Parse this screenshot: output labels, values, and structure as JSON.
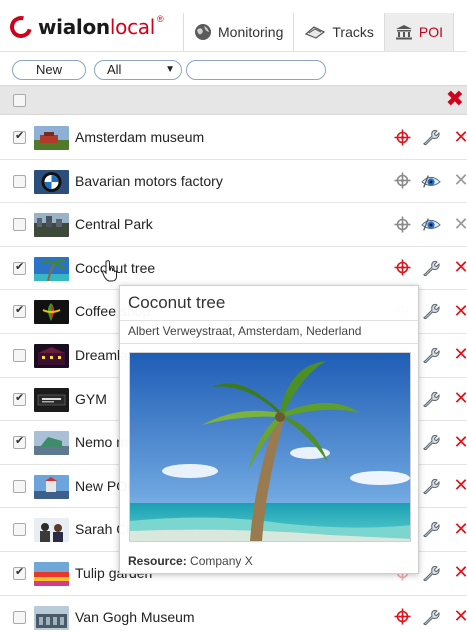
{
  "app": {
    "logo_text": "wialon",
    "logo_accent": "local",
    "logo_sup": "®"
  },
  "tabs": [
    {
      "label": "Monitoring",
      "icon": "globe-icon",
      "active": false
    },
    {
      "label": "Tracks",
      "icon": "tracks-icon",
      "active": false
    },
    {
      "label": "POI",
      "icon": "museum-icon",
      "active": true
    }
  ],
  "toolbar": {
    "new_label": "New",
    "filter_value": "All",
    "filter_caret": "▼",
    "search_value": "",
    "search_placeholder": ""
  },
  "header": {
    "checked": false,
    "delete_icon": "✖"
  },
  "rows": [
    {
      "name": "Amsterdam museum",
      "checked": true,
      "thumb": "museum-thumb",
      "active": true
    },
    {
      "name": "Bavarian motors factory",
      "checked": false,
      "thumb": "bmw-thumb",
      "active": false
    },
    {
      "name": "Central Park",
      "checked": false,
      "thumb": "park-thumb",
      "active": false
    },
    {
      "name": "Coconut tree",
      "checked": true,
      "thumb": "palm-thumb",
      "active": true
    },
    {
      "name": "Coffee shop",
      "checked": true,
      "thumb": "coffee-thumb",
      "active": true
    },
    {
      "name": "Dreamland",
      "checked": false,
      "thumb": "dreamland-thumb",
      "active": true
    },
    {
      "name": "GYM",
      "checked": true,
      "thumb": "gym-thumb",
      "active": true
    },
    {
      "name": "Nemo museum",
      "checked": true,
      "thumb": "nemo-thumb",
      "active": true
    },
    {
      "name": "New POI",
      "checked": false,
      "thumb": "newpoi-thumb",
      "active": true
    },
    {
      "name": "Sarah Chan's place",
      "checked": false,
      "thumb": "sarah-thumb",
      "active": true
    },
    {
      "name": "Tulip garden",
      "checked": true,
      "thumb": "tulip-thumb",
      "active": true
    },
    {
      "name": "Van Gogh Museum",
      "checked": false,
      "thumb": "vangogh-thumb",
      "active": true
    }
  ],
  "popup": {
    "title": "Coconut tree",
    "address": "Albert Verweystraat, Amsterdam, Nederland",
    "resource_label": "Resource:",
    "resource_value": "Company X"
  },
  "colors": {
    "brand_red": "#d0021b",
    "delete_red": "#e0121b",
    "delete_grey": "#9a9a9a",
    "target_red": "#e0121b",
    "target_grey": "#8a8a8a"
  }
}
